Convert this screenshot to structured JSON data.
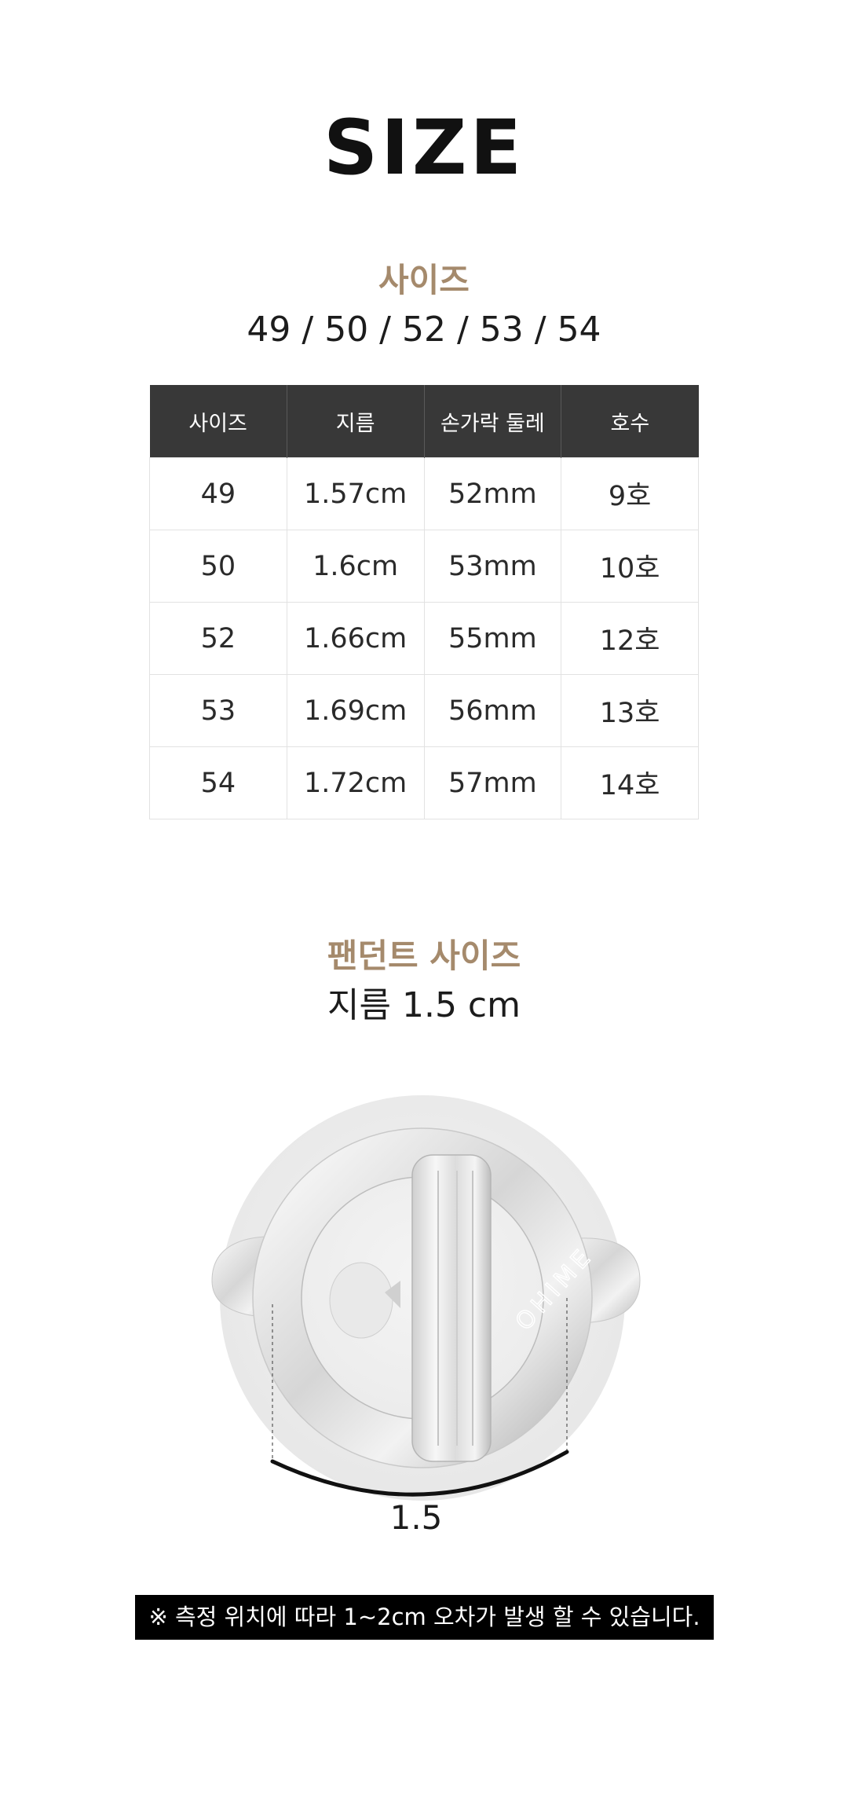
{
  "title": "SIZE",
  "ring_size": {
    "heading": "사이즈",
    "sizes_line": "49 / 50 / 52 / 53 / 54"
  },
  "table": {
    "headers": [
      "사이즈",
      "지름",
      "손가락 둘레",
      "호수"
    ],
    "rows": [
      [
        "49",
        "1.57cm",
        "52mm",
        "9호"
      ],
      [
        "50",
        "1.6cm",
        "53mm",
        "10호"
      ],
      [
        "52",
        "1.66cm",
        "55mm",
        "12호"
      ],
      [
        "53",
        "1.69cm",
        "56mm",
        "13호"
      ],
      [
        "54",
        "1.72cm",
        "57mm",
        "14호"
      ]
    ]
  },
  "pendant": {
    "heading": "팬던트 사이즈",
    "diameter_line": "지름 1.5 cm"
  },
  "figure": {
    "watermark": "OHIME",
    "measure_label": "1.5"
  },
  "notice": "※ 측정 위치에 따라 1~2cm 오차가 발생 할 수 있습니다.",
  "colors": {
    "accent": "#a58a6c",
    "table_header": "#383838",
    "notice_bg": "#000000"
  }
}
